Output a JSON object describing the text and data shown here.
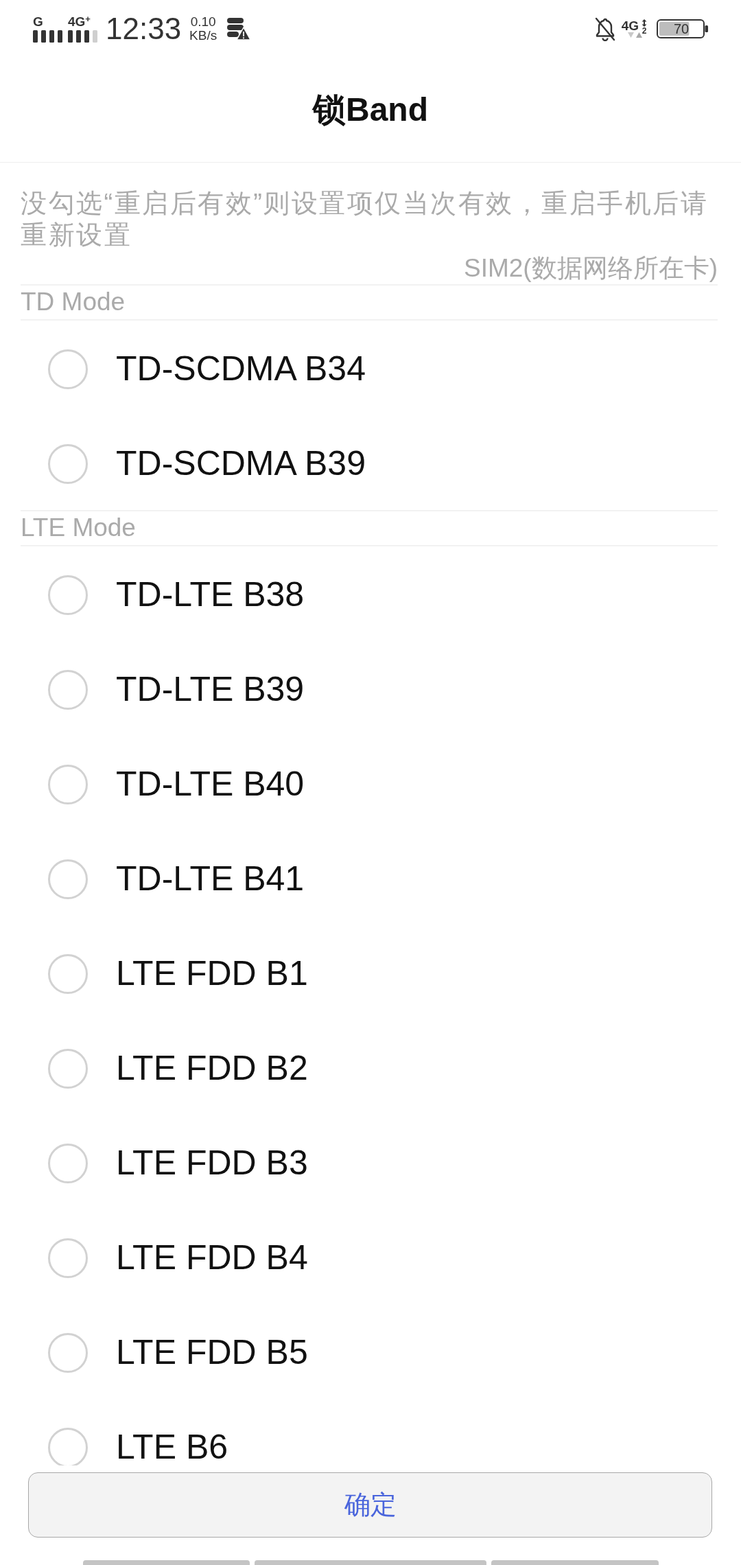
{
  "status_bar": {
    "signal_1": {
      "network": "G"
    },
    "signal_2": {
      "network": "4G$^{+}$"
    },
    "time": "12:33",
    "data_speed": {
      "value": "0.10",
      "unit": "KB/s"
    },
    "mobile_data": {
      "network": "4G",
      "sim": "2"
    },
    "battery": "70"
  },
  "header": {
    "title": "锁Band"
  },
  "note": "没勾选“重启后有效”则设置项仅当次有效，重启手机后请重新设置",
  "sim_label": "SIM2(数据网络所在卡)",
  "sections": [
    {
      "title": "TD Mode",
      "bands": [
        {
          "label": "TD-SCDMA B34",
          "selected": false
        },
        {
          "label": "TD-SCDMA B39",
          "selected": false
        }
      ]
    },
    {
      "title": "LTE Mode",
      "bands": [
        {
          "label": "TD-LTE B38",
          "selected": false
        },
        {
          "label": "TD-LTE B39",
          "selected": false
        },
        {
          "label": "TD-LTE B40",
          "selected": false
        },
        {
          "label": "TD-LTE B41",
          "selected": false
        },
        {
          "label": "LTE FDD B1",
          "selected": false
        },
        {
          "label": "LTE FDD B2",
          "selected": false
        },
        {
          "label": "LTE FDD B3",
          "selected": false
        },
        {
          "label": "LTE FDD B4",
          "selected": false
        },
        {
          "label": "LTE FDD B5",
          "selected": false
        },
        {
          "label": "LTE B6",
          "selected": false
        }
      ]
    }
  ],
  "confirm_button": "确定"
}
